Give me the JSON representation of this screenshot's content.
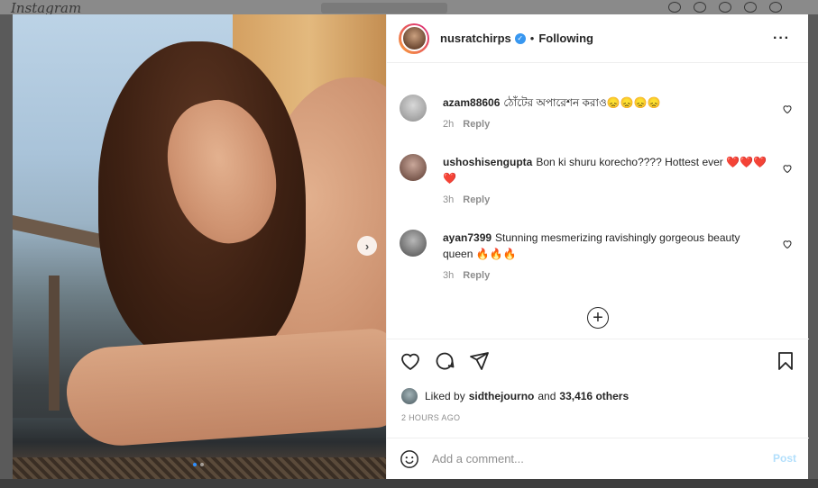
{
  "background": {
    "logo": "Instagram"
  },
  "post": {
    "carousel": {
      "slide_count": 2,
      "active_index": 0
    },
    "next_icon": "chevron-right-icon"
  },
  "header": {
    "username": "nusratchirps",
    "verified_icon": "verified-badge-icon",
    "separator": "•",
    "follow_status": "Following",
    "more_icon": "more-options-icon"
  },
  "comments": [
    {
      "username": "azam88606",
      "text": "ঠোঁটের অপারেশন করাও😞😞😞😞",
      "time": "2h",
      "reply": "Reply"
    },
    {
      "username": "ushoshisengupta",
      "text": "Bon ki shuru korecho???? Hottest ever ❤️❤️❤️❤️",
      "time": "3h",
      "reply": "Reply"
    },
    {
      "username": "ayan7399",
      "text": "Stunning mesmerizing ravishingly gorgeous beauty queen 🔥🔥🔥",
      "time": "3h",
      "reply": "Reply"
    }
  ],
  "load_more_icon": "plus-circle-icon",
  "actions": {
    "like_icon": "heart-icon",
    "comment_icon": "comment-icon",
    "share_icon": "send-icon",
    "save_icon": "bookmark-icon"
  },
  "likes": {
    "prefix": "Liked by",
    "user": "sidthejourno",
    "joiner": "and",
    "others": "33,416 others"
  },
  "timestamp": "2 HOURS AGO",
  "add_comment": {
    "placeholder": "Add a comment...",
    "post_label": "Post",
    "emoji_icon": "smiley-icon"
  },
  "colors": {
    "accent": "#3897f0",
    "post_disabled": "#b2dffc",
    "text": "#262626",
    "muted": "#8e8e8e"
  }
}
